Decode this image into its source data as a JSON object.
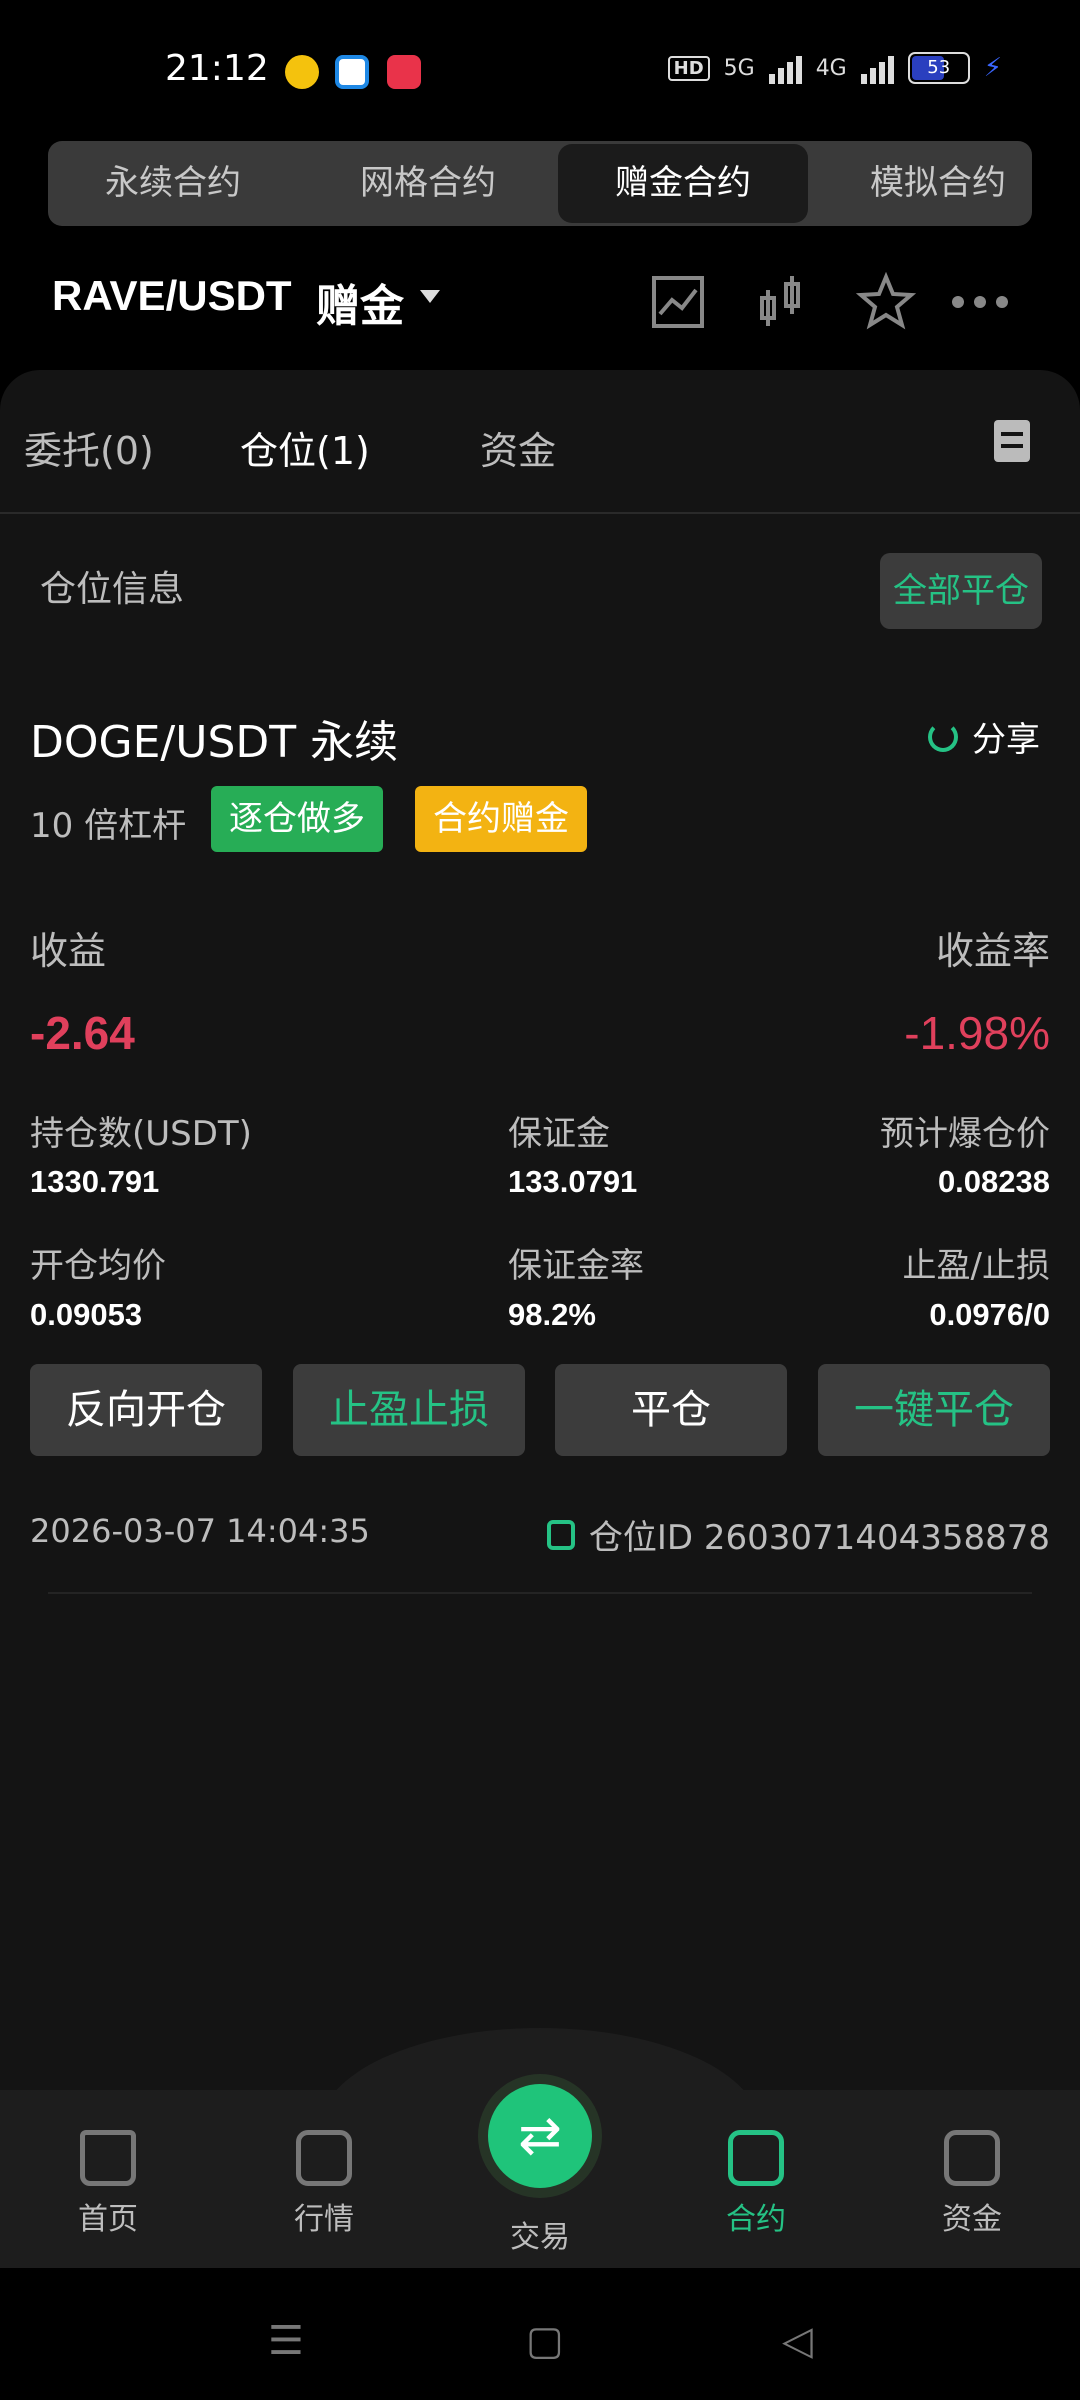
{
  "status_bar": {
    "time": "21:12",
    "network": "5G",
    "network2": "4G",
    "battery": "53"
  },
  "segment_tabs": [
    "永续合约",
    "网格合约",
    "赠金合约",
    "模拟合约"
  ],
  "header": {
    "pair": "RAVE/USDT",
    "pair_type": "赠金"
  },
  "tabs": {
    "orders": "委托(0)",
    "positions": "仓位(1)",
    "funds": "资金"
  },
  "position_section": {
    "title": "仓位信息",
    "close_all": "全部平仓"
  },
  "position": {
    "symbol": "DOGE/USDT 永续",
    "share": "分享",
    "leverage": "10 倍杠杆",
    "mode_badge": "逐仓做多",
    "bonus_badge": "合约赠金",
    "pnl_label": "收益",
    "pnl_value": "-2.64",
    "pnl_rate_label": "收益率",
    "pnl_rate_value": "-1.98%",
    "size_label": "持仓数(USDT)",
    "size_value": "1330.791",
    "margin_label": "保证金",
    "margin_value": "133.0791",
    "liq_label": "预计爆仓价",
    "liq_value": "0.08238",
    "entry_label": "开仓均价",
    "entry_value": "0.09053",
    "margin_rate_label": "保证金率",
    "margin_rate_value": "98.2%",
    "tpsl_label": "止盈/止损",
    "tpsl_value": "0.0976/0",
    "btn_reverse": "反向开仓",
    "btn_tpsl": "止盈止损",
    "btn_close": "平仓",
    "btn_quick_close": "一键平仓",
    "opened_at": "2026-03-07 14:04:35",
    "position_id": "仓位ID 2603071404358878"
  },
  "bottom_nav": {
    "home": "首页",
    "market": "行情",
    "trade": "交易",
    "contract": "合约",
    "assets": "资金"
  },
  "colors": {
    "accent": "#25c285",
    "loss": "#e0405c",
    "badge_green": "#27ad56",
    "badge_yellow": "#f3b312"
  }
}
